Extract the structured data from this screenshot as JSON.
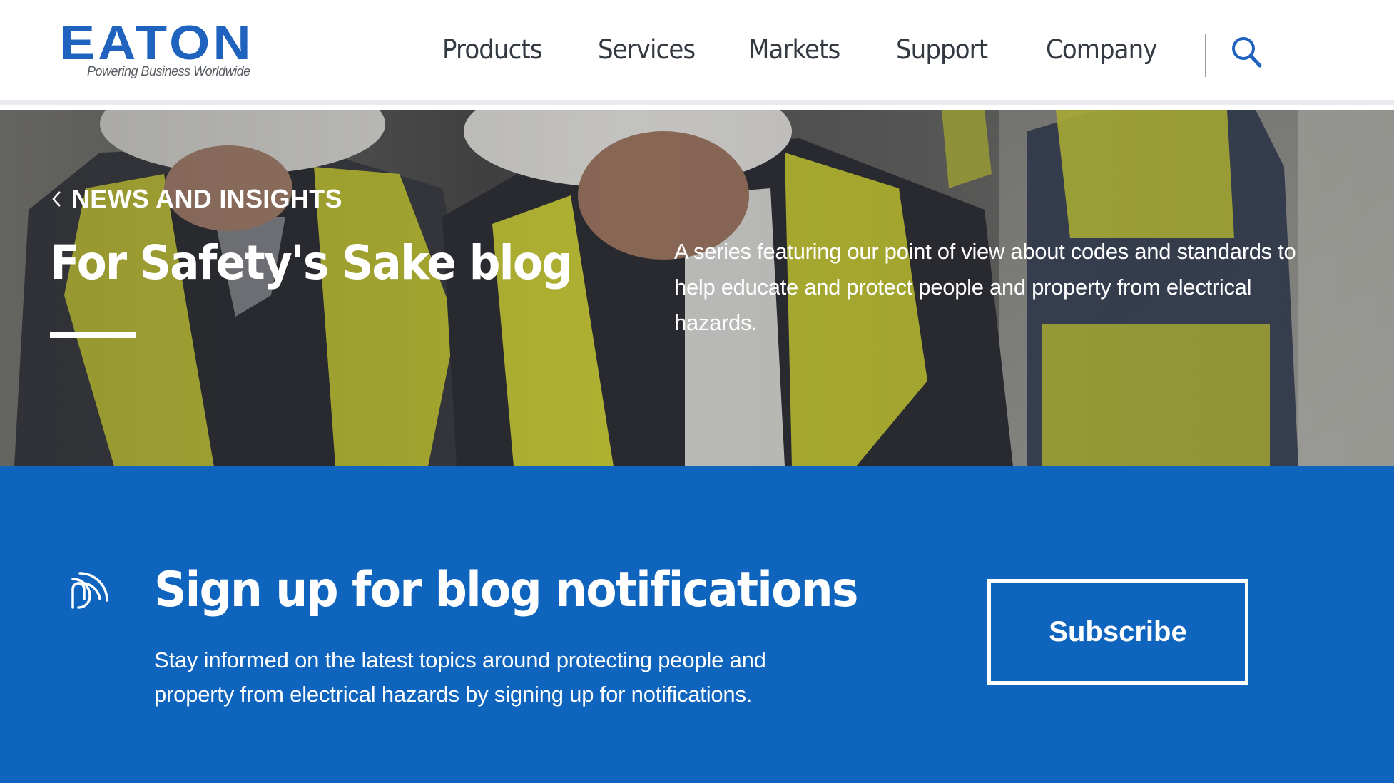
{
  "brand": {
    "name": "EATON",
    "tagline": "Powering Business Worldwide",
    "color": "#1f63bf"
  },
  "nav": {
    "items": [
      {
        "label": "Products"
      },
      {
        "label": "Services"
      },
      {
        "label": "Markets"
      },
      {
        "label": "Support"
      },
      {
        "label": "Company"
      }
    ],
    "search_icon": "search-icon"
  },
  "hero": {
    "breadcrumb": "NEWS AND INSIGHTS",
    "title": "For Safety's Sake blog",
    "description": "A series featuring our point of view about codes and standards to help educate and protect people and property from electrical hazards."
  },
  "signup": {
    "icon": "feed-icon",
    "title": "Sign up for blog notifications",
    "description": "Stay informed on the latest topics around protecting people and property from electrical hazards by signing up for notifications.",
    "button_label": "Subscribe",
    "background_color": "#0f64bd"
  }
}
